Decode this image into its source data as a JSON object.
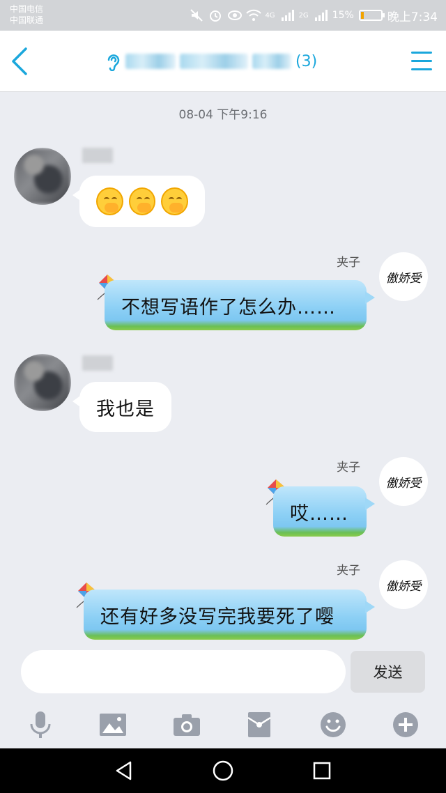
{
  "status_bar": {
    "carrier_1": "中国电信",
    "carrier_2": "中国联通",
    "network_4g": "4G",
    "network_2g": "2G",
    "battery_percent": "15%",
    "battery_level": 0.15,
    "time": "晚上7:34",
    "icons": [
      "mute-icon",
      "alarm-icon",
      "eye-icon",
      "wifi-icon",
      "signal-icon",
      "battery-icon"
    ]
  },
  "header": {
    "member_count": "(3)",
    "icons": [
      "back-icon",
      "ear-icon",
      "menu-icon"
    ]
  },
  "chat": {
    "timestamp": "08-04 下午9:16",
    "messages": [
      {
        "side": "left",
        "emoji_count": 3
      },
      {
        "side": "right",
        "name": "夹子",
        "avatar_text": "傲娇受",
        "text": "不想写语作了怎么办……"
      },
      {
        "side": "left",
        "text": "我也是"
      },
      {
        "side": "right",
        "name": "夹子",
        "avatar_text": "傲娇受",
        "text": "哎……"
      },
      {
        "side": "right",
        "name": "夹子",
        "avatar_text": "傲娇受",
        "text": "还有好多没写完我要死了嘤"
      }
    ]
  },
  "input": {
    "value": "",
    "placeholder": "",
    "send_label": "发送"
  },
  "toolbar": {
    "icons": [
      "microphone-icon",
      "image-icon",
      "camera-icon",
      "red-packet-icon",
      "emoji-icon",
      "plus-icon"
    ],
    "icon_color": "#9aa0ab"
  },
  "colors": {
    "accent": "#1aa7dc",
    "background": "#ebedf2"
  }
}
